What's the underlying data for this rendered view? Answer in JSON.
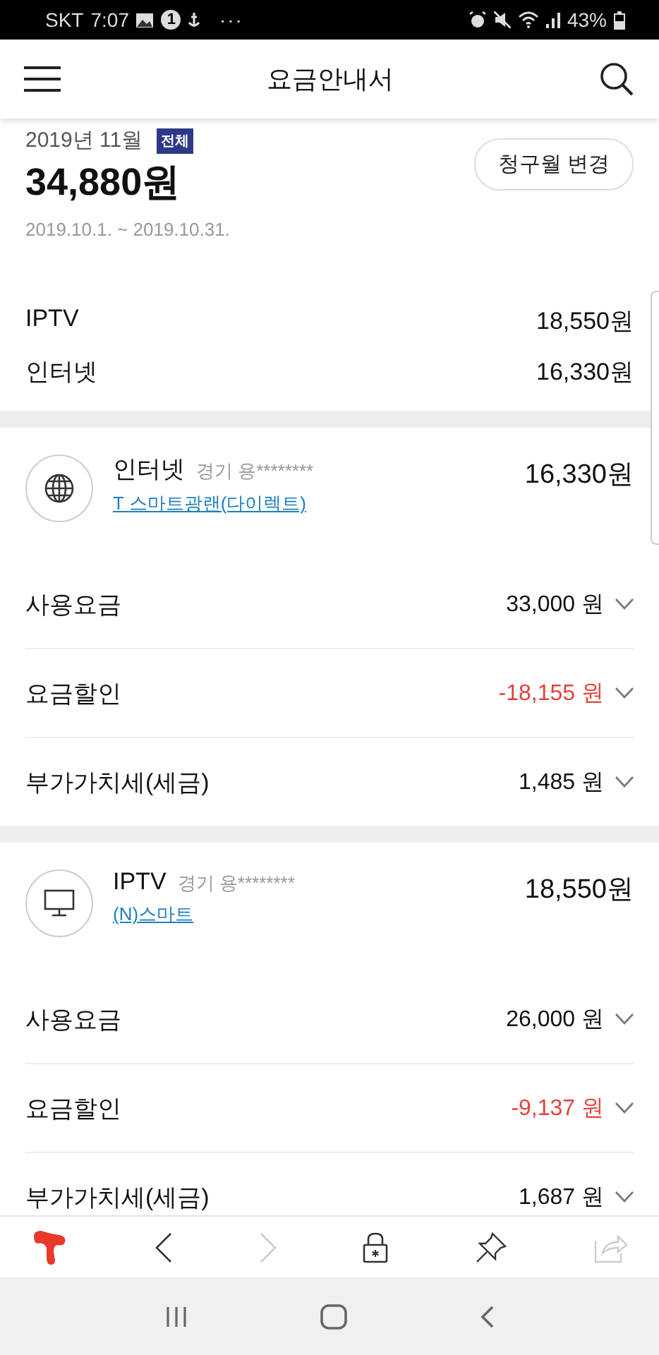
{
  "status_bar": {
    "carrier": "SKT",
    "time": "7:07",
    "notification_count": "1",
    "more": "···",
    "battery": "43%"
  },
  "header": {
    "title": "요금안내서"
  },
  "summary": {
    "month": "2019년 11월",
    "badge": "전체",
    "total": "34,880원",
    "period": "2019.10.1. ~ 2019.10.31.",
    "change_button": "청구월 변경"
  },
  "totals": [
    {
      "name": "IPTV",
      "amount": "18,550원"
    },
    {
      "name": "인터넷",
      "amount": "16,330원"
    }
  ],
  "services": [
    {
      "kind": "internet",
      "name": "인터넷",
      "region": "경기 용********",
      "plan": "T 스마트광랜(다이렉트)",
      "amount": "16,330원",
      "charges": [
        {
          "kind": "charge",
          "label": "사용요금",
          "amount": "33,000 원"
        },
        {
          "kind": "discount",
          "label": "요금할인",
          "amount": "-18,155 원"
        },
        {
          "kind": "charge",
          "label": "부가가치세(세금)",
          "amount": "1,485 원"
        }
      ]
    },
    {
      "kind": "tv",
      "name": "IPTV",
      "region": "경기 용********",
      "plan": "(N)스마트",
      "amount": "18,550원",
      "charges": [
        {
          "kind": "charge",
          "label": "사용요금",
          "amount": "26,000 원"
        },
        {
          "kind": "discount",
          "label": "요금할인",
          "amount": "-9,137 원"
        },
        {
          "kind": "charge",
          "label": "부가가치세(세금)",
          "amount": "1,687 원"
        }
      ]
    }
  ]
}
